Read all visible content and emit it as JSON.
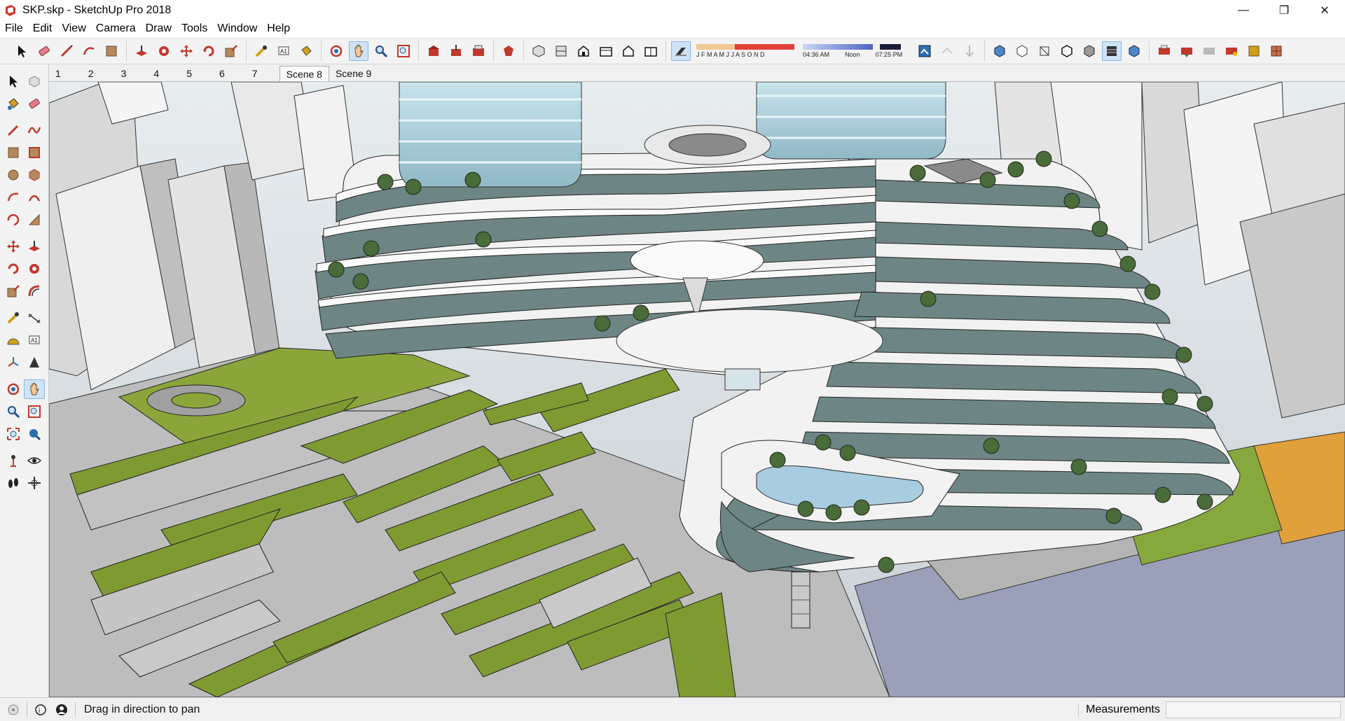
{
  "window": {
    "title": "SKP.skp - SketchUp Pro 2018",
    "minimize_label": "—",
    "restore_label": "❐",
    "close_label": "✕"
  },
  "menu": [
    "File",
    "Edit",
    "View",
    "Camera",
    "Draw",
    "Tools",
    "Window",
    "Help"
  ],
  "toolbar": {
    "shadow_months": "J F M A M J J A S O N D",
    "shadow_times": [
      "04:36 AM",
      "Noon",
      "07:25 PM"
    ],
    "active_tool": "pan-icon"
  },
  "scenes": [
    "1",
    "2",
    "3",
    "4",
    "5",
    "6",
    "7",
    "Scene 8",
    "Scene 9"
  ],
  "status": {
    "hint": "Drag in direction to pan",
    "measurements_label": "Measurements",
    "measurements_value": ""
  },
  "colors": {
    "grass": "#7a9a2e",
    "facade_glass": "#6d8585",
    "building_white": "#f2f2f2",
    "terrain_gray": "#b9b9b9",
    "sky": "#dfe6ea"
  }
}
